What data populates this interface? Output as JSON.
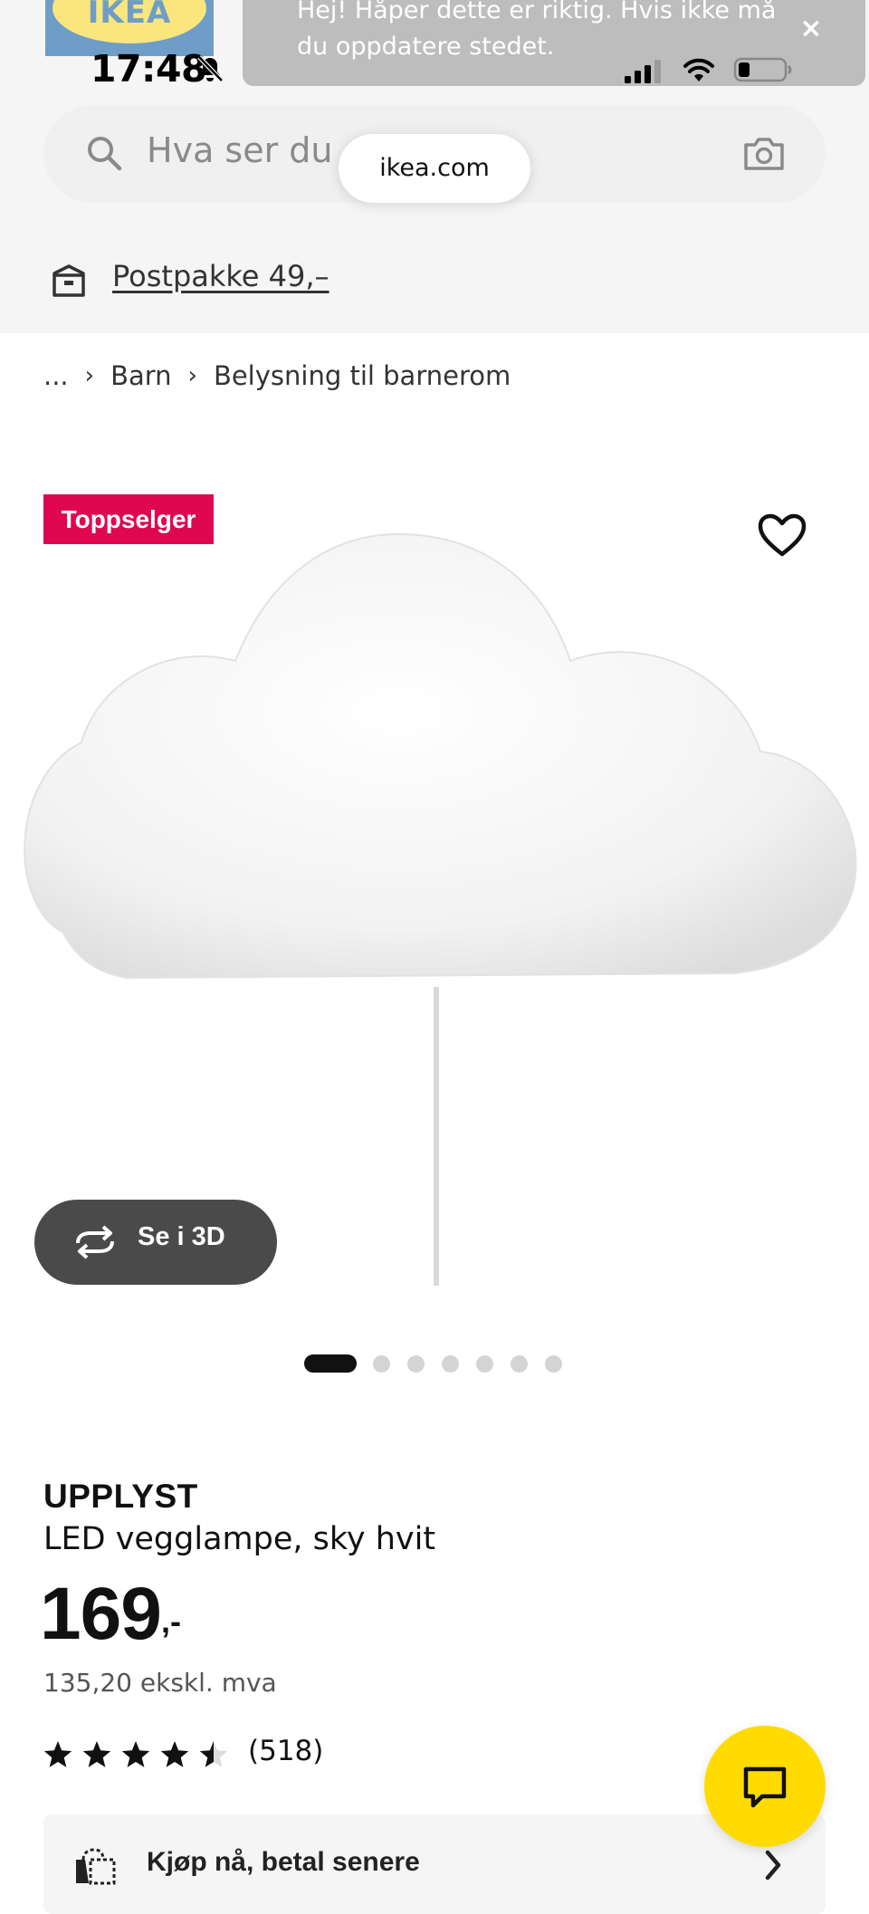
{
  "status_bar": {
    "time": "17:48",
    "icons": [
      "bell-slash-icon",
      "signal-icon",
      "wifi-icon",
      "battery-icon"
    ]
  },
  "brand": {
    "logo_text": "IKEA"
  },
  "toast": {
    "message": "Hej! Håper dette er riktig. Hvis ikke må du oppdatere stedet.",
    "close_symbol": "×"
  },
  "search": {
    "placeholder": "Hva ser du e",
    "url": "ikea.com"
  },
  "shipping": {
    "label": "Postpakke 49,–"
  },
  "breadcrumb": {
    "items": [
      "...",
      "Barn",
      "Belysning til barnerom"
    ],
    "separator": "›"
  },
  "product": {
    "badge": "Toppselger",
    "view_3d_label": "Se i 3D",
    "carousel": {
      "count": 7,
      "active_index": 0
    },
    "name": "UPPLYST",
    "description": "LED vegglampe, sky hvit",
    "price_integer": "169",
    "price_suffix": ",-",
    "price_ex_vat": "135,20 ekskl. mva",
    "rating": {
      "stars": 4.5,
      "max": 5,
      "count_label": "(518)"
    },
    "pay_later_label": "Kjøp nå, betal senere"
  },
  "colors": {
    "badge_red": "#e00751",
    "chat_yellow": "#ffdb00",
    "panel_gray": "#f5f5f5",
    "dark_button": "#4a4a4a"
  }
}
